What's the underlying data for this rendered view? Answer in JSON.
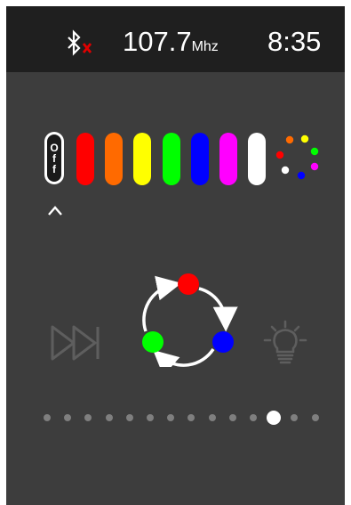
{
  "status_bar": {
    "bluetooth_icon": "bluetooth-disconnected-icon",
    "frequency": "107.7",
    "frequency_unit": "Mhz",
    "time": "8:35"
  },
  "color_selector": {
    "off_label": [
      "O",
      "f",
      "f"
    ],
    "colors": [
      {
        "name": "red",
        "hex": "#ff0000"
      },
      {
        "name": "orange",
        "hex": "#ff6a00"
      },
      {
        "name": "yellow",
        "hex": "#ffff00"
      },
      {
        "name": "green",
        "hex": "#00ff00"
      },
      {
        "name": "blue",
        "hex": "#0000ff"
      },
      {
        "name": "magenta",
        "hex": "#ff00ff"
      },
      {
        "name": "white",
        "hex": "#ffffff"
      }
    ],
    "multicolor_icon": "multicolor-dots-icon",
    "selected": "off"
  },
  "mode_controls": {
    "left_icon": "skip-forward-icon",
    "center_icon": "color-cycle-icon",
    "right_icon": "light-bulb-icon",
    "cycle_colors": {
      "top": "#ff0000",
      "right": "#0000ff",
      "left": "#00ff00"
    }
  },
  "pager": {
    "total": 14,
    "current": 12
  }
}
